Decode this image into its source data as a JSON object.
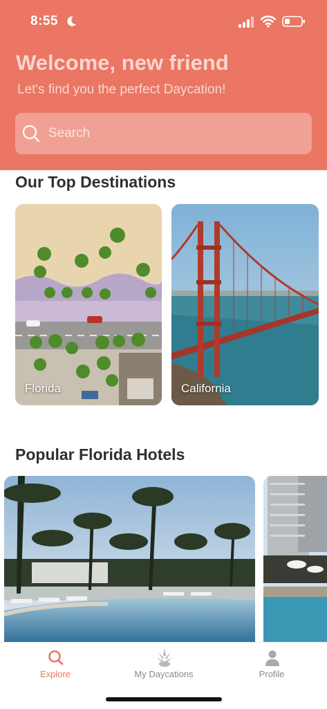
{
  "status_bar": {
    "time": "8:55",
    "icons": [
      "moon-icon",
      "signal-icon",
      "wifi-icon",
      "battery-icon"
    ]
  },
  "header": {
    "welcome": "Welcome, new friend",
    "tagline": "Let's find you the perfect Daycation!"
  },
  "search": {
    "placeholder": "Search"
  },
  "destinations": {
    "title": "Our Top Destinations",
    "items": [
      {
        "label": "Florida"
      },
      {
        "label": "California"
      }
    ]
  },
  "hotels": {
    "title": "Popular Florida Hotels"
  },
  "tabbar": {
    "items": [
      {
        "label": "Explore",
        "icon": "search-icon",
        "active": true
      },
      {
        "label": "My Daycations",
        "icon": "pineapple-icon",
        "active": false
      },
      {
        "label": "Profile",
        "icon": "person-icon",
        "active": false
      }
    ]
  },
  "colors": {
    "accent": "#ea7663",
    "search_bg": "#f1a094",
    "muted": "#8a8a8a"
  }
}
